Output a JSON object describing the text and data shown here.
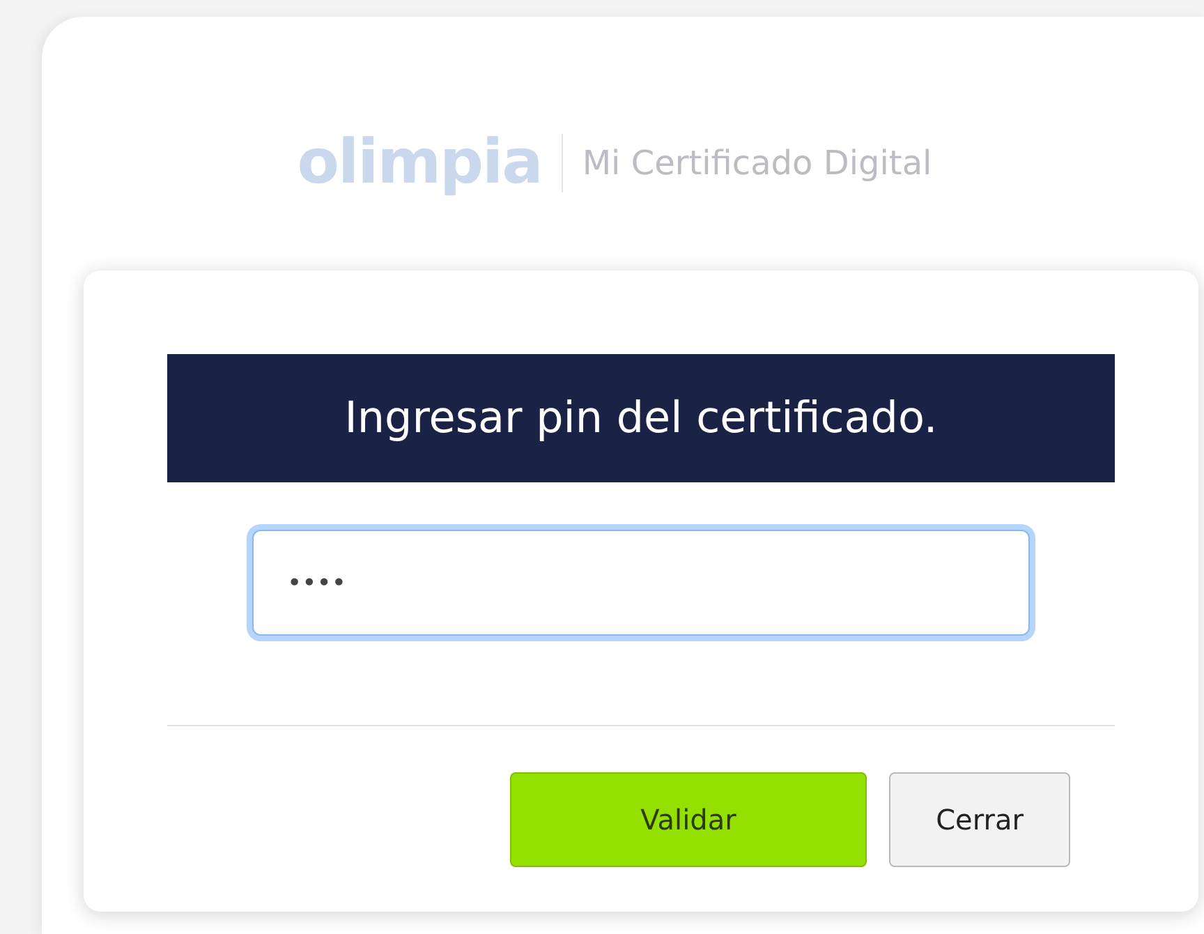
{
  "header": {
    "logo": "olimpia",
    "subtitle": "Mi Certificado Digital"
  },
  "dialog": {
    "title": "Ingresar pin del certificado.",
    "pin_field": {
      "value": "••••",
      "focused": true
    },
    "buttons": [
      {
        "label": "Validar",
        "kind": "primary"
      },
      {
        "label": "Cerrar",
        "kind": "secondary"
      }
    ]
  }
}
